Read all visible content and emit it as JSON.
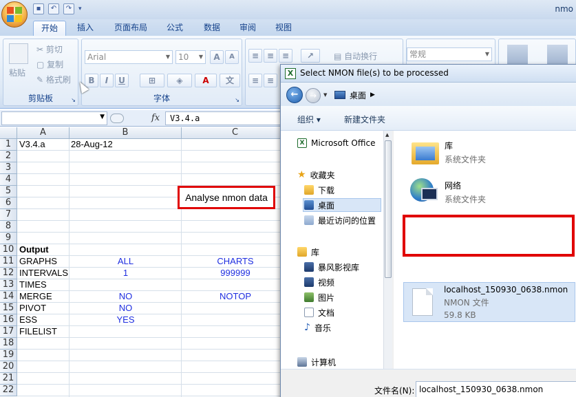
{
  "window": {
    "title": "nmo"
  },
  "ribbon": {
    "tabs": [
      "开始",
      "插入",
      "页面布局",
      "公式",
      "数据",
      "审阅",
      "视图"
    ],
    "clipboard": {
      "paste": "粘贴",
      "cut": "剪切",
      "copy": "复制",
      "format_painter": "格式刷",
      "label": "剪贴板"
    },
    "font": {
      "family": "Arial",
      "size": "10",
      "label": "字体",
      "bold": "B",
      "italic": "I",
      "underline": "U"
    },
    "alignment": {
      "wrap_text": "自动换行"
    },
    "number": {
      "format": "常规"
    }
  },
  "formula_bar": {
    "fx": "fx",
    "value": "V3.4.a"
  },
  "grid": {
    "columns": [
      "A",
      "B",
      "C"
    ],
    "rows": [
      "1",
      "2",
      "3",
      "4",
      "5",
      "6",
      "7",
      "8",
      "9",
      "10",
      "11",
      "12",
      "13",
      "14",
      "15",
      "16",
      "17",
      "18",
      "19",
      "20",
      "21",
      "22"
    ],
    "cells": {
      "a1": "V3.4.a",
      "b1": "28-Aug-12",
      "a10": "Output",
      "a11": "GRAPHS",
      "b11": "ALL",
      "c11": "CHARTS",
      "a12": "INTERVALS",
      "b12": "1",
      "c12": "999999",
      "a13": "TIMES",
      "a14": "MERGE",
      "b14": "NO",
      "c14": "NOTOP",
      "a15": "PIVOT",
      "b15": "NO",
      "a16": "ESS",
      "b16": "YES",
      "a17": "FILELIST"
    },
    "analyse_button": "Analyse nmon data"
  },
  "dialog": {
    "title": "Select NMON file(s) to be processed",
    "breadcrumb": "桌面",
    "toolbar": {
      "organize": "组织 ▾",
      "new_folder": "新建文件夹"
    },
    "nav": {
      "microsoft_office": "Microsoft Office",
      "favorites": "收藏夹",
      "downloads": "下载",
      "desktop": "桌面",
      "recent": "最近访问的位置",
      "libraries": "库",
      "storm_video": "暴风影视库",
      "videos": "视频",
      "pictures": "图片",
      "documents": "文档",
      "music": "音乐",
      "computer": "计算机"
    },
    "files": [
      {
        "name": "库",
        "sub": "系统文件夹",
        "icon": "library-folder-icon"
      },
      {
        "name": "网络",
        "sub": "系统文件夹",
        "icon": "network-icon"
      },
      {
        "name": "localhost_150930_0638.nmon",
        "sub": "NMON 文件",
        "size": "59.8 KB",
        "icon": "file-icon"
      }
    ],
    "filename_label": "文件名(N):",
    "filename_value": "localhost_150930_0638.nmon"
  },
  "colors": {
    "highlight_red": "#e00000",
    "ribbon_blue": "#15428b",
    "cell_blue": "#1e2ee0"
  }
}
